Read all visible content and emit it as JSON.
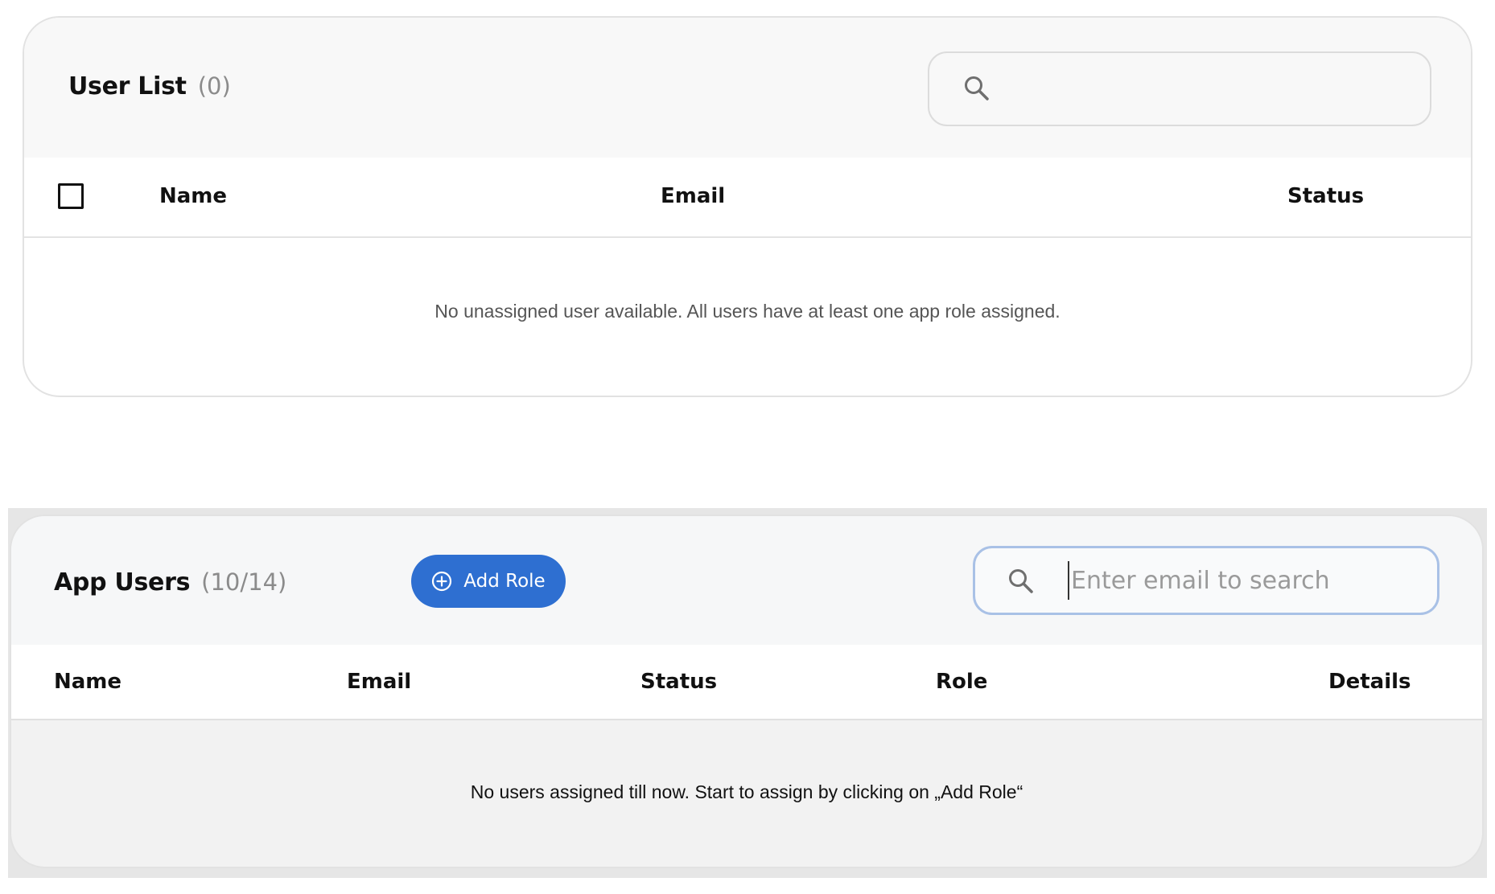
{
  "user_list": {
    "title": "User List",
    "count": "(0)",
    "search": {
      "value": "",
      "placeholder": ""
    },
    "columns": {
      "name": "Name",
      "email": "Email",
      "status": "Status"
    },
    "select_all_checked": false,
    "empty_message": "No unassigned user available. All users have at least one app role assigned."
  },
  "app_users": {
    "title": "App Users",
    "count": "(10/14)",
    "add_role_label": "Add Role",
    "search": {
      "value": "",
      "placeholder": "Enter email to search"
    },
    "columns": {
      "name": "Name",
      "email": "Email",
      "status": "Status",
      "role": "Role",
      "details": "Details"
    },
    "empty_message": "No users assigned till now. Start to assign by clicking on „Add Role“"
  },
  "icons": {
    "search": "search-icon",
    "add_role": "plus-circle-icon"
  },
  "colors": {
    "accent": "#2e6fd1",
    "focus_border": "#a9c1e6",
    "muted_text": "#8b8b8b"
  }
}
